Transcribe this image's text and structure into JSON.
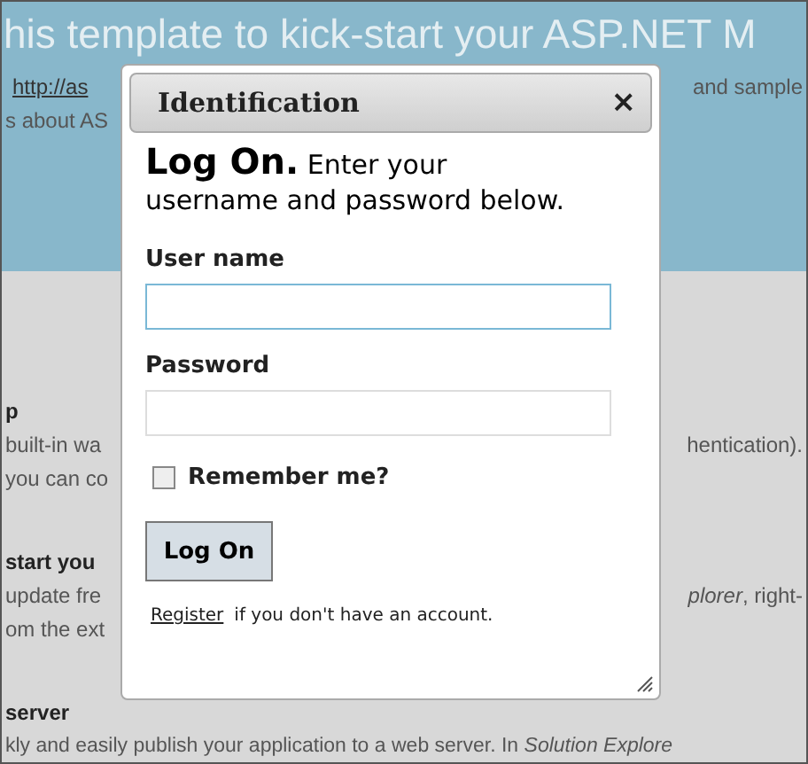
{
  "page": {
    "heading": "his template to kick-start your ASP.NET M",
    "rows": [
      {
        "kind": "link",
        "left": "http://as",
        "right": "and sample"
      },
      {
        "kind": "text",
        "left": "s about AS"
      },
      {
        "kind": "gap"
      },
      {
        "kind": "bold",
        "left": "p"
      },
      {
        "kind": "text",
        "left": "built-in wa",
        "right": "hentication)."
      },
      {
        "kind": "text",
        "left": "you can co"
      },
      {
        "kind": "gap"
      },
      {
        "kind": "bold",
        "left": "start you"
      },
      {
        "kind": "text",
        "left": "update fre",
        "right": "*plorer*, right-"
      },
      {
        "kind": "text",
        "left": "om the ext"
      },
      {
        "kind": "gap"
      },
      {
        "kind": "bold",
        "left": "server"
      },
      {
        "kind": "wide",
        "left": "kly and easily publish your application to a web server. In *Solution Explore*"
      }
    ]
  },
  "dialog": {
    "title": "Identification",
    "close": "×",
    "heading": "Log On.",
    "intro": "Enter your username and password below.",
    "fields": [
      {
        "label": "User name",
        "focused": true
      },
      {
        "label": "Password",
        "focused": false
      }
    ],
    "remember": {
      "label": "Remember me?",
      "checked": false
    },
    "submit": "Log On",
    "register_link": "Register",
    "register_text": "if you don't have an account."
  }
}
